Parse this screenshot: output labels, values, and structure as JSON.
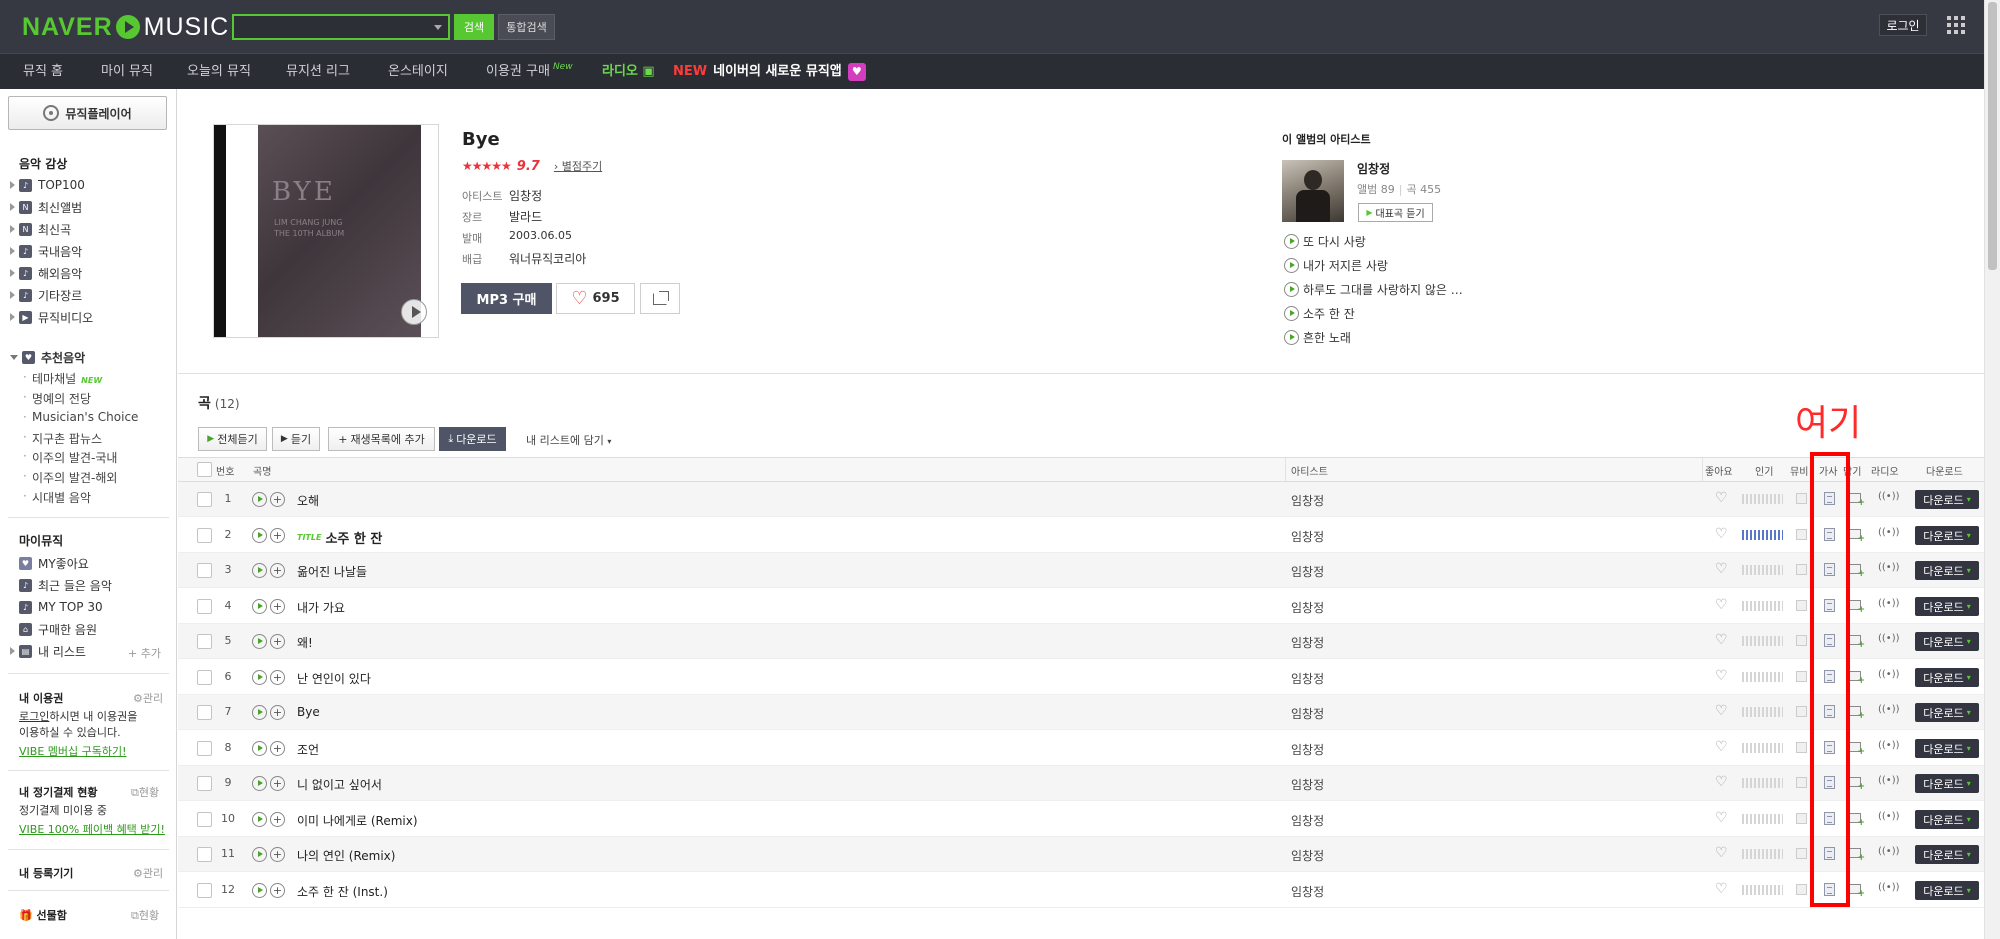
{
  "header": {
    "logo_naver": "NAVER",
    "logo_music": "MUSIC",
    "search_button": "검색",
    "total_search_button": "통합검색",
    "login": "로그인"
  },
  "nav": {
    "items": [
      "뮤직 홈",
      "마이 뮤직",
      "오늘의 뮤직",
      "뮤지션 리그",
      "온스테이지",
      "이용권 구매"
    ],
    "new_tag": "New",
    "radio": "라디오",
    "new_red": "NEW",
    "promo": "네이버의 새로운 뮤직앱"
  },
  "sidebar": {
    "player_button": "뮤직플레이어",
    "listen_heading": "음악 감상",
    "listen_items": [
      "TOP100",
      "최신앨범",
      "최신곡",
      "국내음악",
      "해외음악",
      "기타장르",
      "뮤직비디오"
    ],
    "recommend_heading": "추천음악",
    "recommend_items": [
      "테마채널",
      "명예의 전당",
      "Musician's Choice",
      "지구촌 팝뉴스",
      "이주의 발견-국내",
      "이주의 발견-해외",
      "시대별 음악"
    ],
    "new_tag": "NEW",
    "mymusic_heading": "마이뮤직",
    "mymusic_items": [
      "MY좋아요",
      "최근 들은 음악",
      "MY TOP 30",
      "구매한 음원",
      "내 리스트"
    ],
    "add_label": "+ 추가",
    "pass_heading": "내 이용권",
    "manage": "관리",
    "pass_login": "로그인",
    "pass_text1": "하시면 내 이용권을",
    "pass_text2": "이용하실 수 있습니다.",
    "pass_link": "VIBE 멤버십 구독하기!",
    "billing_heading": "내 정기결제 현황",
    "status": "현황",
    "billing_text": "정기결제 미이용 중",
    "billing_link": "VIBE 100% 페이백 혜택 받기!",
    "device_heading": "내 등록기기",
    "gift_heading": "선물함"
  },
  "album": {
    "title": "Bye",
    "stars": "★★★★★",
    "score": "9.7",
    "rate_link": "별점주기",
    "cover_title": "BYE",
    "cover_sub1": "LIM CHANG JUNG",
    "cover_sub2": "THE 10TH ALBUM",
    "meta": [
      {
        "label": "아티스트",
        "value": "임창정"
      },
      {
        "label": "장르",
        "value": "발라드"
      },
      {
        "label": "발매",
        "value": "2003.06.05"
      },
      {
        "label": "배급",
        "value": "워너뮤직코리아"
      }
    ],
    "mp3_button": "MP3 구매",
    "likes": "695"
  },
  "artist_panel": {
    "heading": "이 앨범의 아티스트",
    "name": "임창정",
    "albums": "앨범 89",
    "songs": "곡 455",
    "top_button": "대표곡 듣기",
    "tracks": [
      "또 다시 사랑",
      "내가 저지른 사랑",
      "하루도 그대를 사랑하지 않은 …",
      "소주 한 잔",
      "흔한 노래"
    ]
  },
  "songs": {
    "heading": "곡",
    "count": "(12)",
    "toolbar": {
      "play_all": "전체듣기",
      "play": "듣기",
      "add_playlist": "재생목록에 추가",
      "download": "다운로드",
      "add_mylist": "내 리스트에 담기"
    },
    "columns": {
      "number": "번호",
      "title": "곡명",
      "artist": "아티스트",
      "like": "좋아요",
      "popularity": "인기",
      "mv": "뮤비",
      "lyrics": "가사",
      "save": "담기",
      "radio": "라디오",
      "download": "다운로드"
    },
    "title_badge": "TITLE",
    "download_label": "다운로드",
    "rows": [
      {
        "num": "1",
        "title": "오해",
        "artist": "임창정",
        "popularity": 0,
        "is_title": false
      },
      {
        "num": "2",
        "title": "소주 한 잔",
        "artist": "임창정",
        "popularity": 1.0,
        "is_title": true
      },
      {
        "num": "3",
        "title": "옮어진 나날들",
        "artist": "임창정",
        "popularity": 0,
        "is_title": false
      },
      {
        "num": "4",
        "title": "내가 가요",
        "artist": "임창정",
        "popularity": 0,
        "is_title": false
      },
      {
        "num": "5",
        "title": "왜!",
        "artist": "임창정",
        "popularity": 0,
        "is_title": false
      },
      {
        "num": "6",
        "title": "난 연인이 있다",
        "artist": "임창정",
        "popularity": 0,
        "is_title": false
      },
      {
        "num": "7",
        "title": "Bye",
        "artist": "임창정",
        "popularity": 0,
        "is_title": false
      },
      {
        "num": "8",
        "title": "조언",
        "artist": "임창정",
        "popularity": 0,
        "is_title": false
      },
      {
        "num": "9",
        "title": "니 없이고 싶어서",
        "artist": "임창정",
        "popularity": 0,
        "is_title": false
      },
      {
        "num": "10",
        "title": "이미 나에게로 (Remix)",
        "artist": "임창정",
        "popularity": 0,
        "is_title": false
      },
      {
        "num": "11",
        "title": "나의 연인 (Remix)",
        "artist": "임창정",
        "popularity": 0,
        "is_title": false
      },
      {
        "num": "12",
        "title": "소주 한 잔 (Inst.)",
        "artist": "임창정",
        "popularity": 0,
        "is_title": false
      }
    ]
  },
  "annotation": {
    "label": "여기",
    "color": "#ff0000"
  },
  "colors": {
    "brand_green": "#58c832",
    "header_bg": "#363842",
    "accent_red": "#e8343a"
  }
}
